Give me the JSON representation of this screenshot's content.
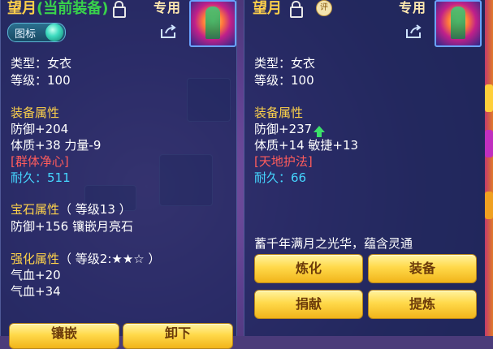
{
  "left": {
    "name": "望月",
    "current_tag": "(当前装备)",
    "exclusive": "专用",
    "tujian_label": "图标",
    "type": "类型：女衣",
    "level": "等级：100",
    "attr_header": "装备属性",
    "defense": "防御+204",
    "stats": "体质+38 力量-9",
    "special_skill": "[群体净心]",
    "durability_label": "耐久：",
    "durability_value": "511",
    "gem_header": "宝石属性",
    "gem_level": "（ 等级13 ）",
    "gem_effect": "防御+156 镶嵌月亮石",
    "enhance_header": "强化属性",
    "enhance_level": "（ 等级2:★★☆ ）",
    "enhance_1": "气血+20",
    "enhance_2": "气血+34",
    "btn_1": "镶嵌",
    "btn_2": "卸下"
  },
  "right": {
    "name": "望月",
    "eval_badge": "评",
    "exclusive": "专用",
    "type": "类型：女衣",
    "level": "等级：100",
    "attr_header": "装备属性",
    "defense": "防御+237",
    "stats": "体质+14 敏捷+13",
    "special_skill": "[天地护法]",
    "durability_label": "耐久：",
    "durability_value": "66",
    "description": "蓄千年满月之光华，蕴含灵通",
    "btn_refine": "炼化",
    "btn_equip": "装备",
    "btn_donate": "捐献",
    "btn_extract": "提炼"
  },
  "colors": {
    "title": "#ffd04a",
    "current": "#39d24b",
    "section": "#ffd34a",
    "skill": "#ff5c5c",
    "durability": "#45d6ff",
    "button": "#ffd94a"
  },
  "icons": [
    "lock-icon",
    "share-icon",
    "eval-badge-icon",
    "up-arrow-icon",
    "gem-orb-icon"
  ]
}
